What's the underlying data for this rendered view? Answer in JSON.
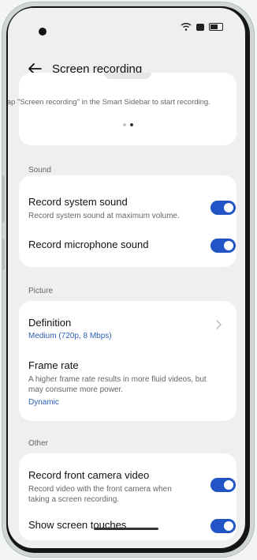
{
  "header": {
    "title": "Screen recording"
  },
  "hint": {
    "text": "Tap \"Screen recording\" in the Smart Sidebar to start recording."
  },
  "sections": {
    "sound": {
      "label": "Sound",
      "items": [
        {
          "title": "Record system sound",
          "subtitle": "Record system sound at maximum volume.",
          "enabled": true
        },
        {
          "title": "Record microphone sound",
          "enabled": true
        }
      ]
    },
    "picture": {
      "label": "Picture",
      "definition": {
        "title": "Definition",
        "value": "Medium (720p, 8 Mbps)"
      },
      "frame_rate": {
        "title": "Frame rate",
        "subtitle_line1": "A higher frame rate results in more fluid videos, but",
        "subtitle_line2": "may consume more power.",
        "value": "Dynamic"
      }
    },
    "other": {
      "label": "Other",
      "items": [
        {
          "title": "Record front camera video",
          "subtitle_line1": "Record video with the front camera when",
          "subtitle_line2": "taking a screen recording.",
          "enabled": true
        },
        {
          "title": "Show screen touches",
          "enabled": true
        }
      ]
    }
  },
  "colors": {
    "accent": "#2354c6",
    "link": "#2e5fb0",
    "background": "#efefef",
    "card": "#ffffff"
  },
  "icons": {
    "back": "arrow-left-icon",
    "chevron": "chevron-right-icon",
    "wifi": "wifi-icon",
    "battery": "battery-icon"
  }
}
